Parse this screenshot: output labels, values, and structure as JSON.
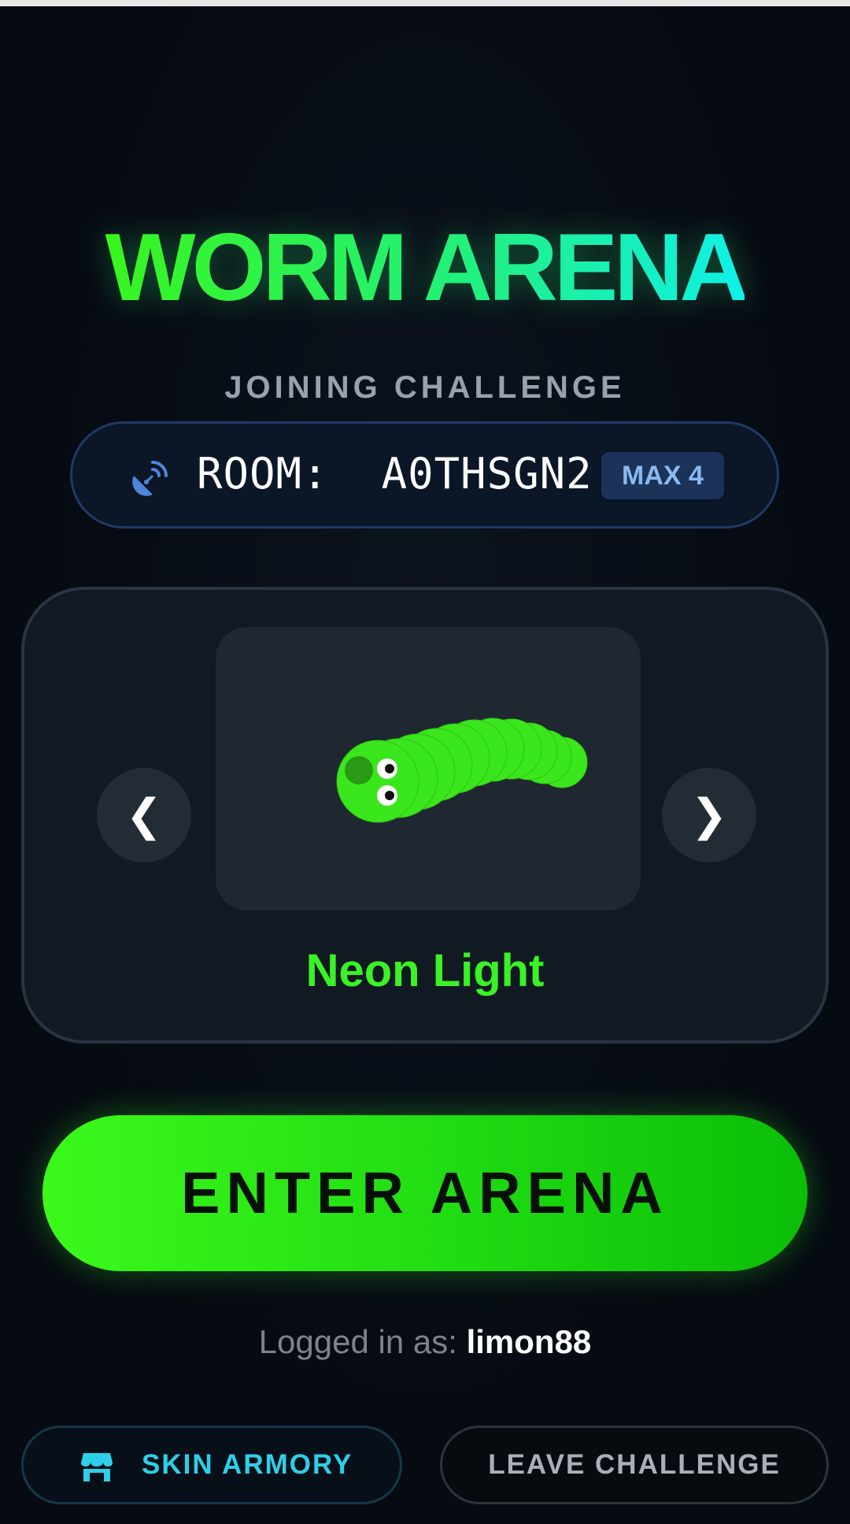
{
  "app": {
    "title": "WORM ARENA",
    "subtitle": "JOINING CHALLENGE"
  },
  "room": {
    "label": "ROOM:  A0THSGN2",
    "max_badge": "MAX 4",
    "icon": "satellite-dish-icon"
  },
  "skin_selector": {
    "prev_label": "❮",
    "next_label": "❯",
    "skin_name": "Neon Light",
    "skin_color": "#3af226"
  },
  "actions": {
    "enter_label": "ENTER ARENA",
    "armory_label": "SKIN ARMORY",
    "armory_icon": "store-icon",
    "leave_label": "LEAVE CHALLENGE"
  },
  "user": {
    "logged_prefix": "Logged in as:",
    "username": "limon88"
  },
  "colors": {
    "accent_green": "#39f51f",
    "accent_cyan": "#10f0e8",
    "room_badge": "#8ab9f0",
    "armory_text": "#2ecfe8"
  }
}
